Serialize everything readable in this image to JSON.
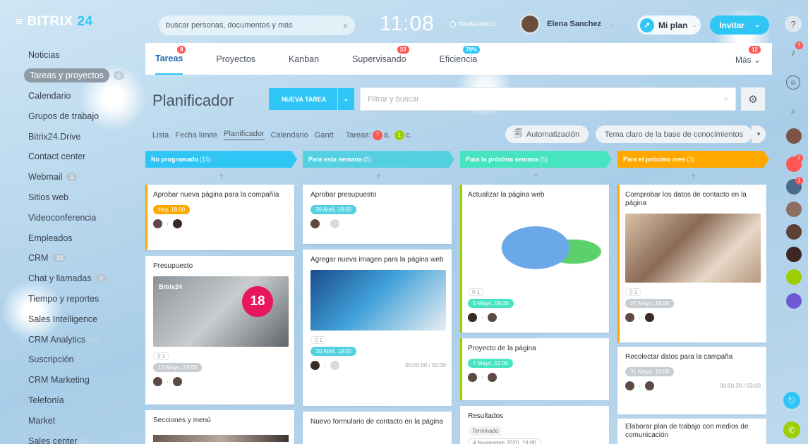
{
  "brand": {
    "name": "BITRIX",
    "suffix": "24"
  },
  "sidebar": {
    "items": [
      {
        "label": "Noticias",
        "count": "",
        "beta": ""
      },
      {
        "label": "Tareas y proyectos",
        "count": "6",
        "beta": "",
        "active": true
      },
      {
        "label": "Calendario",
        "count": "",
        "beta": ""
      },
      {
        "label": "Grupos de trabajo",
        "count": "",
        "beta": ""
      },
      {
        "label": "Bitrix24.Drive",
        "count": "",
        "beta": ""
      },
      {
        "label": "Contact center",
        "count": "",
        "beta": ""
      },
      {
        "label": "Webmail",
        "count": "1",
        "beta": ""
      },
      {
        "label": "Sitios web",
        "count": "",
        "beta": ""
      },
      {
        "label": "Videoconferencia",
        "count": "",
        "beta": "beta"
      },
      {
        "label": "Empleados",
        "count": "",
        "beta": ""
      },
      {
        "label": "CRM",
        "count": "33",
        "beta": ""
      },
      {
        "label": "Chat y llamadas",
        "count": "3",
        "beta": ""
      },
      {
        "label": "Tiempo y reportes",
        "count": "",
        "beta": ""
      },
      {
        "label": "Sales Intelligence",
        "count": "",
        "beta": ""
      },
      {
        "label": "CRM Analytics",
        "count": "",
        "beta": "beta"
      },
      {
        "label": "Suscripción",
        "count": "",
        "beta": ""
      },
      {
        "label": "CRM Marketing",
        "count": "",
        "beta": ""
      },
      {
        "label": "Telefonía",
        "count": "",
        "beta": ""
      },
      {
        "label": "Market",
        "count": "",
        "beta": ""
      },
      {
        "label": "Sales center",
        "count": "",
        "beta": "beta"
      }
    ]
  },
  "topbar": {
    "search_placeholder": "buscar personas, documentos y más",
    "clock": "11:08",
    "status": "TRABAJANDO",
    "user_name": "Elena Sanchez",
    "plan_label": "Mi plan",
    "invite_label": "Invitar"
  },
  "tabs": {
    "items": [
      {
        "label": "Tareas",
        "badge": "8",
        "badge_color": "red",
        "active": true
      },
      {
        "label": "Proyectos",
        "badge": ""
      },
      {
        "label": "Kanban",
        "badge": ""
      },
      {
        "label": "Supervisando",
        "badge": "33",
        "badge_color": "red"
      },
      {
        "label": "Eficiencia",
        "badge": "79%",
        "badge_color": "blue"
      }
    ],
    "more_label": "Más",
    "more_badge": "12"
  },
  "toolbar": {
    "page_title": "Planificador",
    "new_task_label": "NUEVA TAREA",
    "filter_placeholder": "Filtrar y buscar"
  },
  "views": {
    "items": [
      "Lista",
      "Fecha límite",
      "Planificador",
      "Calendario",
      "Gantt"
    ],
    "active": "Planificador",
    "tasks_label": "Tareas:",
    "tasks_counter_1": "7",
    "tasks_counter_1_text": "a.",
    "tasks_counter_2": "1",
    "tasks_counter_2_text": "c.",
    "more": "...",
    "automation_label": "Automatización",
    "kb_label": "Tema claro de la base de conocimientos"
  },
  "columns": [
    {
      "title": "No programado",
      "count": "(15)",
      "color": "#2fc6f6"
    },
    {
      "title": "Para esta semana",
      "count": "(5)",
      "color": "#55d0e0"
    },
    {
      "title": "Para la próxima semana",
      "count": "(5)",
      "color": "#47e4c2"
    },
    {
      "title": "Para el próximo mes",
      "count": "(3)",
      "color": "#ffa900"
    }
  ],
  "cards": {
    "c1": {
      "title": "Aprobar nueva página para la compañía",
      "date": "Hoy, 18:00"
    },
    "c2": {
      "title": "Presupuesto",
      "img_text": "Bitrix24",
      "cal": "18",
      "counter": "0 1",
      "date": "13 Mayo, 23:00"
    },
    "c3": {
      "title": "Secciones y menú"
    },
    "c4": {
      "title": "Aprobar presupuesto",
      "date": "30 Abril, 18:00"
    },
    "c5": {
      "title": "Agregar nueva imagen para la página web",
      "counter": "0 1",
      "date": "30 Abril, 19:00",
      "timer": "00:00:00 / 02:00"
    },
    "c6": {
      "title": "Nuevo formulario de contacto en la página"
    },
    "c7": {
      "title": "Actualizar la página web",
      "counter": "0 1",
      "date": "5 Mayo, 19:00"
    },
    "c8": {
      "title": "Proyecto de la página",
      "date": "7 Mayo, 11:00"
    },
    "c9": {
      "title": "Resultados",
      "status": "Terminado",
      "date": "4 Noviembre 2020, 19:00"
    },
    "c10": {
      "title": "Comprobar los datos de contacto en la página",
      "counter": "0 1",
      "date": "27 Mayo, 18:00"
    },
    "c11": {
      "title": "Recolectar datos para la campaña",
      "date": "31 Mayo, 18:00",
      "timer": "00:00:39 / 03:00"
    },
    "c12": {
      "title": "Elaborar plan de trabajo con medios de comunicación"
    }
  },
  "colors": {
    "accent": "#2fc6f6",
    "red": "#ff5752",
    "green": "#9dcf00",
    "orange": "#ffa900"
  }
}
